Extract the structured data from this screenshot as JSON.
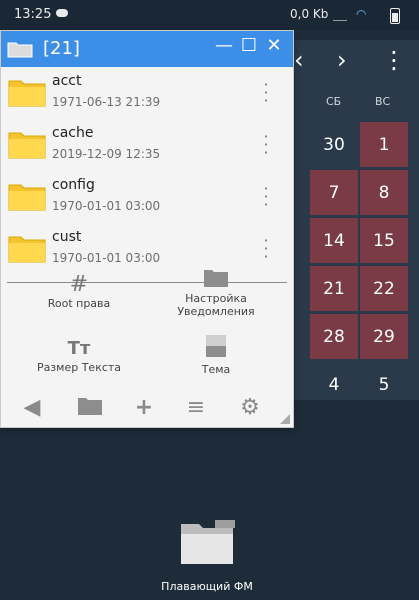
{
  "statusbar": {
    "time": "13:25",
    "network": "0,0 Kb"
  },
  "calendar": {
    "nav_prev": "‹",
    "nav_next": "›",
    "nav_menu": "⋮",
    "dow": [
      "СБ",
      "ВС"
    ],
    "rows": [
      [
        "30",
        "1"
      ],
      [
        "7",
        "8"
      ],
      [
        "14",
        "15"
      ],
      [
        "21",
        "22"
      ],
      [
        "28",
        "29"
      ],
      [
        "4",
        "5"
      ]
    ]
  },
  "window": {
    "title": "[21]",
    "files": [
      {
        "name": "acct",
        "date": "1971-06-13 21:39"
      },
      {
        "name": "cache",
        "date": "2019-12-09 12:35"
      },
      {
        "name": "config",
        "date": "1970-01-01 03:00"
      },
      {
        "name": "cust",
        "date": "1970-01-01 03:00"
      }
    ],
    "tools": [
      {
        "icon": "#",
        "label": "Root права"
      },
      {
        "icon": "folder",
        "label": "Настройка\nУведомления"
      },
      {
        "icon": "Tт",
        "label": "Размер Текста"
      },
      {
        "icon": "theme",
        "label": "Тема"
      }
    ]
  },
  "shortcut": {
    "label": "Плавающий ФМ"
  },
  "colors": {
    "titlebar": "#3d8ee6",
    "calendar_highlight": "#7a3b47",
    "folder": "#f4c430"
  }
}
